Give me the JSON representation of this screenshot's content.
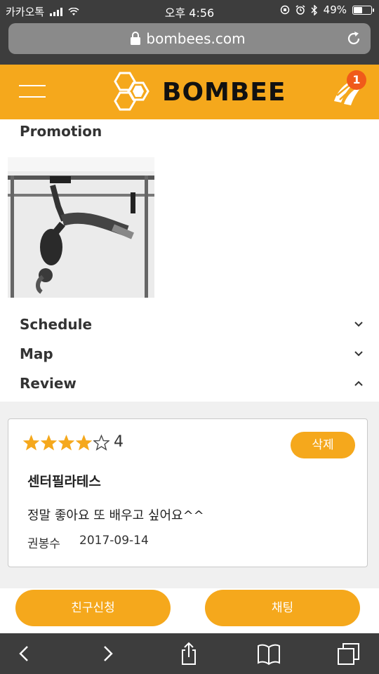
{
  "status_bar": {
    "carrier": "카카오톡",
    "time": "오후 4:56",
    "battery_percent": "49%",
    "battery_level": 0.49
  },
  "browser": {
    "url": "bombees.com"
  },
  "header": {
    "brand": "BOMBEE",
    "notification_count": "1",
    "accent_color": "#f5a81c",
    "badge_color": "#f05a1a"
  },
  "sections": {
    "promotion": "Promotion",
    "schedule": "Schedule",
    "map": "Map",
    "review": "Review"
  },
  "review": {
    "rating": 4,
    "max_rating": 5,
    "rating_label": "4",
    "delete_label": "삭제",
    "center_name": "센터필라테스",
    "text": "정말 좋아요 또 배우고 싶어요^^",
    "author": "권봉수",
    "date": "2017-09-14"
  },
  "actions": {
    "friend_request": "친구신청",
    "chat": "채팅"
  },
  "icons": {
    "lock": "lock-icon",
    "reload": "reload-icon",
    "menu": "hamburger-menu-icon",
    "logo": "honeycomb-logo-icon",
    "notification": "notification-wings-icon",
    "back": "back-arrow-icon",
    "forward": "forward-arrow-icon",
    "share": "share-icon",
    "bookmarks": "book-icon",
    "tabs": "tabs-icon"
  }
}
